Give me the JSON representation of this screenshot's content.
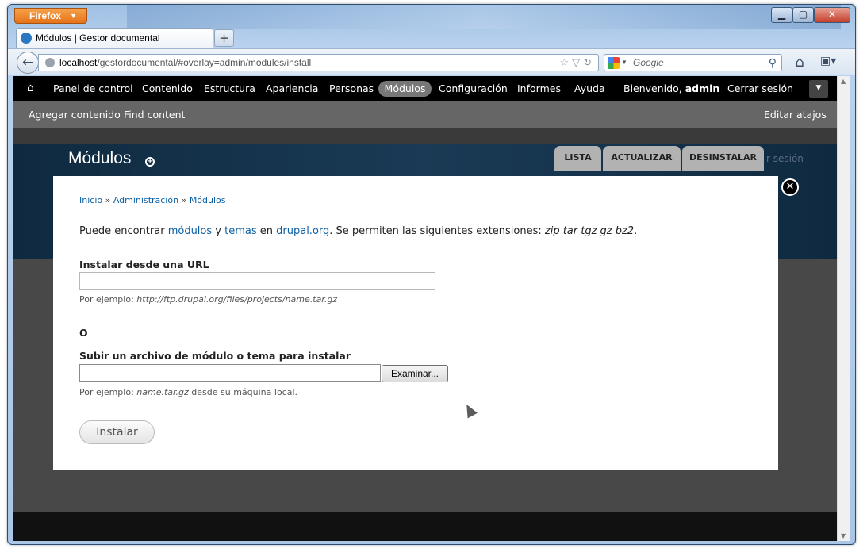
{
  "firefox_button": "Firefox",
  "window_controls": {
    "minimize": "▁",
    "maximize": "▢",
    "close": "✕"
  },
  "tab": {
    "title": "Módulos | Gestor documental",
    "new_tab": "+"
  },
  "address": {
    "host": "localhost",
    "path": "/gestordocumental/#overlay=admin/modules/install"
  },
  "search": {
    "placeholder": "Google"
  },
  "toolbar": {
    "items": [
      "Panel de control",
      "Contenido",
      "Estructura",
      "Apariencia",
      "Personas",
      "Módulos",
      "Configuración",
      "Informes",
      "Ayuda"
    ],
    "welcome": "Bienvenido,",
    "user": "admin",
    "logout": "Cerrar sesión"
  },
  "shortcuts": {
    "add_content": "Agregar contenido",
    "find_content": "Find content",
    "edit_shortcuts": "Editar atajos"
  },
  "header": {
    "title": "Módulos",
    "ghost_text": "r sesión"
  },
  "overlay_tabs": [
    "LISTA",
    "ACTUALIZAR",
    "DESINSTALAR"
  ],
  "breadcrumb": {
    "home": "Inicio",
    "sep": "»",
    "admin": "Administración",
    "modules": "Módulos"
  },
  "intro": {
    "p1": "Puede encontrar ",
    "modules_link": "módulos",
    "p2": " y ",
    "themes_link": "temas",
    "p3": " en ",
    "drupal_link": "drupal.org",
    "p4": ". Se permiten las siguientes extensiones: ",
    "extensions": "zip tar tgz gz bz2",
    "p5": "."
  },
  "url_field": {
    "label": "Instalar desde una URL",
    "desc_prefix": "Por ejemplo: ",
    "desc_example": "http://ftp.drupal.org/files/projects/name.tar.gz"
  },
  "or_label": "O",
  "upload_field": {
    "label": "Subir un archivo de módulo o tema para instalar",
    "browse": "Examinar...",
    "desc_prefix": "Por ejemplo: ",
    "desc_example": "name.tar.gz",
    "desc_suffix": " desde su máquina local."
  },
  "install_button": "Instalar"
}
